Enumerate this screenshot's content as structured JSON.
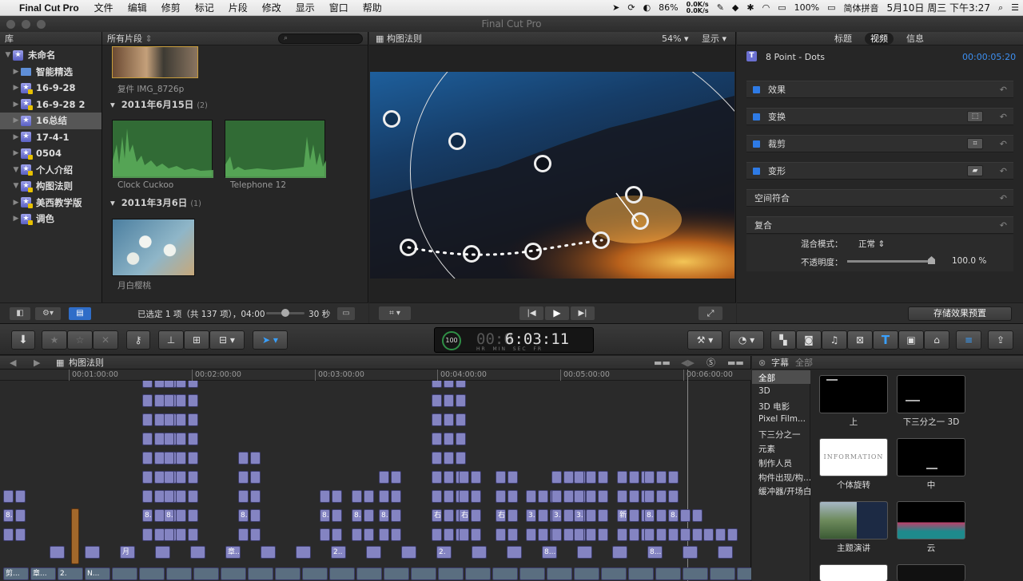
{
  "menubar": {
    "app": "Final Cut Pro",
    "items": [
      "文件",
      "编辑",
      "修剪",
      "标记",
      "片段",
      "修改",
      "显示",
      "窗口",
      "帮助"
    ],
    "battery_meter": "86%",
    "net_speed_up": "0.0K/s",
    "net_speed_down": "0.0K/s",
    "battery": "100%",
    "input_method": "简体拼音",
    "clock": "5月10日 周三 下午3:27"
  },
  "window_title": "Final Cut Pro",
  "library": {
    "header": "库",
    "items": [
      {
        "label": "未命名",
        "level": 0,
        "type": "library"
      },
      {
        "label": "智能精选",
        "level": 1,
        "type": "folder"
      },
      {
        "label": "16-9-28",
        "level": 1,
        "type": "event"
      },
      {
        "label": "16-9-28 2",
        "level": 1,
        "type": "event"
      },
      {
        "label": "16总结",
        "level": 1,
        "type": "event",
        "selected": true
      },
      {
        "label": "17-4-1",
        "level": 1,
        "type": "event"
      },
      {
        "label": "0504",
        "level": 1,
        "type": "event"
      },
      {
        "label": "个人介绍",
        "level": 1,
        "type": "event"
      },
      {
        "label": "构图法则",
        "level": 1,
        "type": "event"
      },
      {
        "label": "美西教学版",
        "level": 1,
        "type": "event"
      },
      {
        "label": "调色",
        "level": 1,
        "type": "event"
      }
    ]
  },
  "browser": {
    "filter": "所有片段",
    "clip_top": "复件 IMG_8726p",
    "group1_date": "2011年6月15日",
    "group1_count": "(2)",
    "group1_clips": [
      "Clock Cuckoo",
      "Telephone 12"
    ],
    "group2_date": "2011年3月6日",
    "group2_count": "(1)",
    "group2_clip": "月白樱桃",
    "status": "已选定 1 项（共 137 项），04:00",
    "duration": "30 秒"
  },
  "viewer": {
    "title": "构图法则",
    "zoom": "54%",
    "view_menu": "显示"
  },
  "inspector": {
    "tabs": [
      "标题",
      "视频",
      "信息"
    ],
    "active_tab": "视频",
    "clip_name": "8 Point - Dots",
    "timecode": "00:00:05:20",
    "sections": [
      "效果",
      "变换",
      "裁剪",
      "变形",
      "空间符合",
      "复合"
    ],
    "blend_label": "混合模式：",
    "blend_value": "正常",
    "opacity_label": "不透明度：",
    "opacity_value": "100.0 %",
    "opacity": 1.0,
    "save_preset": "存储效果预置"
  },
  "toolbar": {
    "timecode": "6:03:11",
    "timecode_dim": "00:0",
    "tc_units": [
      "HR",
      "MIN",
      "SEC",
      "FR"
    ],
    "percent": "100"
  },
  "timeline": {
    "title": "构图法则",
    "ruler": [
      "00:01:00:00",
      "00:02:00:00",
      "00:03:00:00",
      "00:04:00:00",
      "00:05:00:00",
      "00:06:00:00"
    ],
    "clip_labels": [
      "剪...",
      "章...",
      "2.",
      "N...",
      "月",
      "章...",
      "2..",
      "2.",
      "8...",
      "8...",
      "8...",
      "8...",
      "8...",
      "8...",
      "8...",
      "8...",
      "8...",
      "右",
      "右",
      "右",
      "3.",
      "3.",
      "3.",
      "新",
      "8.",
      "8...",
      "章..",
      "剪.."
    ]
  },
  "titles_browser": {
    "header": "字幕",
    "filter": "全部",
    "categories": [
      "全部",
      "3D",
      "3D 电影",
      "Pixel Film...",
      "下三分之一",
      "元素",
      "制作人员",
      "构件出现/构...",
      "缓冲器/开场白"
    ],
    "items": [
      "上",
      "下三分之一 3D",
      "个体旋转",
      "中",
      "主题演讲",
      "云"
    ],
    "information_text": "INFORMATION"
  },
  "colors": {
    "accent": "#2e7be6",
    "clip": "#8484c2",
    "audio_clip": "#a3682b"
  }
}
